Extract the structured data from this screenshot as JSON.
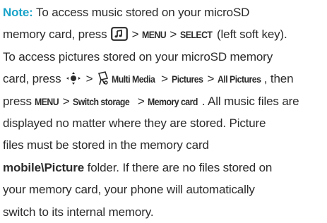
{
  "note": {
    "label": "Note:",
    "lines": {
      "l1_text": " To access music stored on your microSD",
      "l2_a": "memory card, press ",
      "l2_b": " > ",
      "l2_menu": "MENU",
      "l2_c": " > ",
      "l2_select": "SELECT",
      "l2_d": " (left soft key).",
      "l3": "To access pictures stored on your microSD memory",
      "l4_a": "card, press ",
      "l4_b": " > ",
      "l4_multimedia": "Multi Media",
      "l4_c": " > ",
      "l4_pictures": "Pictures",
      "l4_d": " > ",
      "l4_allpictures": "All Pictures",
      "l4_e": ", then",
      "l5_a": "press ",
      "l5_menu": "MENU",
      "l5_b": " > ",
      "l5_switch": "Switch storage",
      "l5_c": " > ",
      "l5_memcard": "Memory card",
      "l5_d": ". All music files are",
      "l6": "displayed no matter where they are stored. Picture",
      "l7": "files must be stored in the memory card",
      "l8_folder": "mobile\\Picture",
      "l8_rest": " folder. If there are no files stored on",
      "l9": "your memory card, your phone will automatically",
      "l10": "switch to its internal memory."
    }
  },
  "icons": {
    "music_key": "music-key-icon",
    "nav_key": "navigation-key-icon",
    "multimedia": "multimedia-icon"
  },
  "colors": {
    "label": "#1aa3c9",
    "text": "#2b2b2b"
  }
}
